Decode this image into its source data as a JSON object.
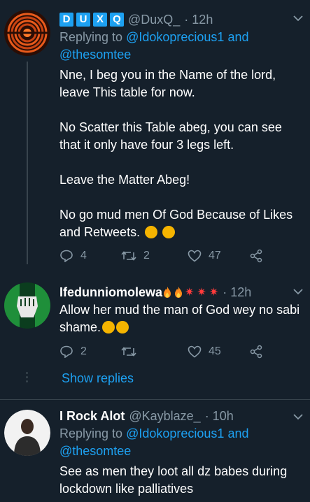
{
  "tweets": [
    {
      "badges": [
        "D",
        "U",
        "X",
        "Q"
      ],
      "handle": "@DuxQ_",
      "time": "· 12h",
      "replying_label": "Replying to",
      "reply_to_1": "@Idokoprecious1",
      "reply_and": "and",
      "reply_to_2": "@thesomtee",
      "text": "Nne, I beg you in the Name of the lord, leave This table for now.\n\nNo Scatter this Table abeg, you can see that it only have four 3 legs left.\n\nLeave the Matter Abeg!\n\nNo go mud men Of God Because of Likes and Retweets.",
      "replies": "4",
      "retweets": "2",
      "likes": "47"
    },
    {
      "name": "Ifedunniomolewa",
      "time": "· 12h",
      "text": "Allow her mud the man of God wey no sabi shame.",
      "replies": "2",
      "retweets": "",
      "likes": "45"
    },
    {
      "name": "I Rock Alot",
      "handle": "@Kayblaze_",
      "time": "· 10h",
      "replying_label": "Replying to",
      "reply_to_1": "@Idokoprecious1",
      "reply_and": "and",
      "reply_to_2": "@thesomtee",
      "text": "See as men they loot all dz babes during lockdown like palliatives"
    }
  ],
  "show_replies": "Show replies",
  "colors": {
    "background": "#15202b",
    "muted": "#8899a6",
    "accent": "#1da1f2",
    "divider": "#38444d"
  }
}
